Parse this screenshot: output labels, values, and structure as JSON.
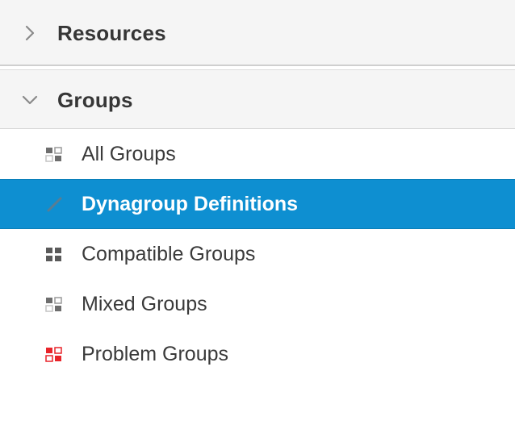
{
  "sections": {
    "resources": {
      "label": "Resources",
      "expanded": false,
      "chevron_icon": "chevron-right-icon"
    },
    "groups": {
      "label": "Groups",
      "expanded": true,
      "chevron_icon": "chevron-down-icon"
    }
  },
  "groups_items": [
    {
      "label": "All Groups",
      "icon": "group-mixed-icon",
      "active": false
    },
    {
      "label": "Dynagroup Definitions",
      "icon": "pencil-icon",
      "active": true
    },
    {
      "label": "Compatible Groups",
      "icon": "group-compatible-icon",
      "active": false
    },
    {
      "label": "Mixed Groups",
      "icon": "group-mixed-icon",
      "active": false
    },
    {
      "label": "Problem Groups",
      "icon": "group-problem-icon",
      "active": false
    }
  ],
  "colors": {
    "selected_background": "#0e8fd1",
    "header_background": "#f5f5f5",
    "problem_icon": "#e8242a",
    "text": "#3a3a3a"
  }
}
